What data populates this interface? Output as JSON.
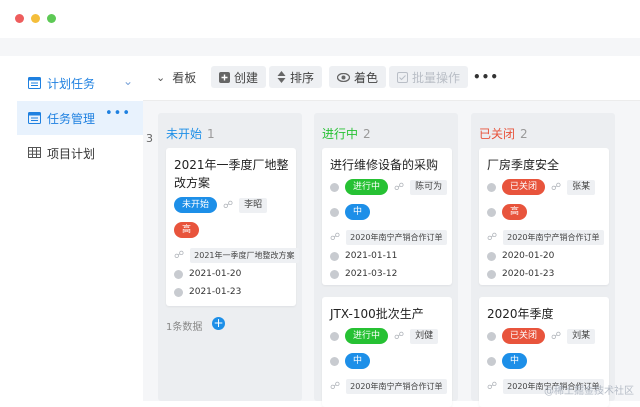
{
  "sidebar": {
    "items": [
      {
        "label": "计划任务",
        "icon": "calendar-icon"
      },
      {
        "label": "任务管理",
        "icon": "calendar-icon"
      },
      {
        "label": "项目计划",
        "icon": "table-icon"
      }
    ]
  },
  "toolbar": {
    "view_label": "看板",
    "create_label": "创建",
    "sort_label": "排序",
    "color_label": "着色",
    "batch_label": "批量操作",
    "more_label": "•••"
  },
  "left_edge_count": "3",
  "columns": [
    {
      "title": "未开始",
      "count": "1",
      "color": "#1d8fe8",
      "footer": "1条数据",
      "cards": [
        {
          "title": "2021年一季度厂地整改方案",
          "status": "未开始",
          "owner": "李昭",
          "priority": "高",
          "project": "2021年一季度厂地整改方案",
          "start": "2021-01-20",
          "end": "2021-01-23"
        }
      ]
    },
    {
      "title": "进行中",
      "count": "2",
      "color": "#26c133",
      "cards": [
        {
          "title": "进行维修设备的采购",
          "status": "进行中",
          "owner": "陈可为",
          "priority": "中",
          "project": "2020年南宁产销合作订单",
          "start": "2021-01-11",
          "end": "2021-03-12"
        },
        {
          "title": "JTX-100批次生产",
          "status": "进行中",
          "owner": "刘健",
          "priority": "中",
          "project": "2020年南宁产销合作订单"
        }
      ]
    },
    {
      "title": "已关闭",
      "count": "2",
      "color": "#e8543c",
      "cards": [
        {
          "title": "厂房季度安全",
          "status": "已关闭",
          "owner": "张某",
          "priority": "高",
          "project": "2020年南宁产销合作订单",
          "start": "2020-01-20",
          "end": "2020-01-23"
        },
        {
          "title": "2020年季度",
          "status": "已关闭",
          "owner": "刘某",
          "priority": "中",
          "project": "2020年南宁产销合作订单"
        }
      ]
    }
  ],
  "watermark": "@稀土掘金技术社区"
}
